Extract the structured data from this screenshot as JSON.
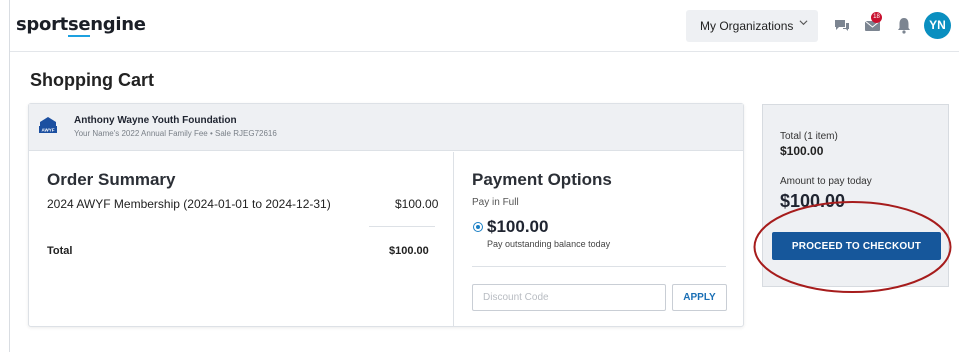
{
  "header": {
    "logo_text_pre": "sport",
    "logo_text_mid": "se",
    "logo_text_post": "ngine",
    "org_menu_label": "My Organizations",
    "message_badge_count": "18",
    "avatar_initials": "YN"
  },
  "page": {
    "title": "Shopping Cart"
  },
  "cart": {
    "org_name": "Anthony Wayne Youth Foundation",
    "org_logo_text": "AWYF",
    "org_subtitle": "Your Name's  2022 Annual Family Fee • Sale RJEG72616",
    "order_summary_title": "Order Summary",
    "items": [
      {
        "description": "2024 AWYF Membership (2024-01-01 to 2024-12-31)",
        "price": "$100.00"
      }
    ],
    "total_label": "Total",
    "total_value": "$100.00"
  },
  "payment": {
    "title": "Payment Options",
    "option_label": "Pay in Full",
    "amount": "$100.00",
    "note": "Pay outstanding balance today",
    "discount_placeholder": "Discount Code",
    "discount_value": "",
    "apply_label": "APPLY"
  },
  "summary": {
    "total_label": "Total (1 item)",
    "total_value": "$100.00",
    "pay_today_label": "Amount to pay today",
    "pay_today_value": "$100.00",
    "checkout_label": "PROCEED TO CHECKOUT"
  },
  "colors": {
    "brand_blue": "#16579b",
    "accent_cyan": "#1da1e0",
    "badge_red": "#c8102e",
    "annotation_red": "#a61c1c"
  },
  "icons": [
    "chevron-down-icon",
    "chat-icon",
    "envelope-icon",
    "bell-icon",
    "org-logo-icon"
  ]
}
